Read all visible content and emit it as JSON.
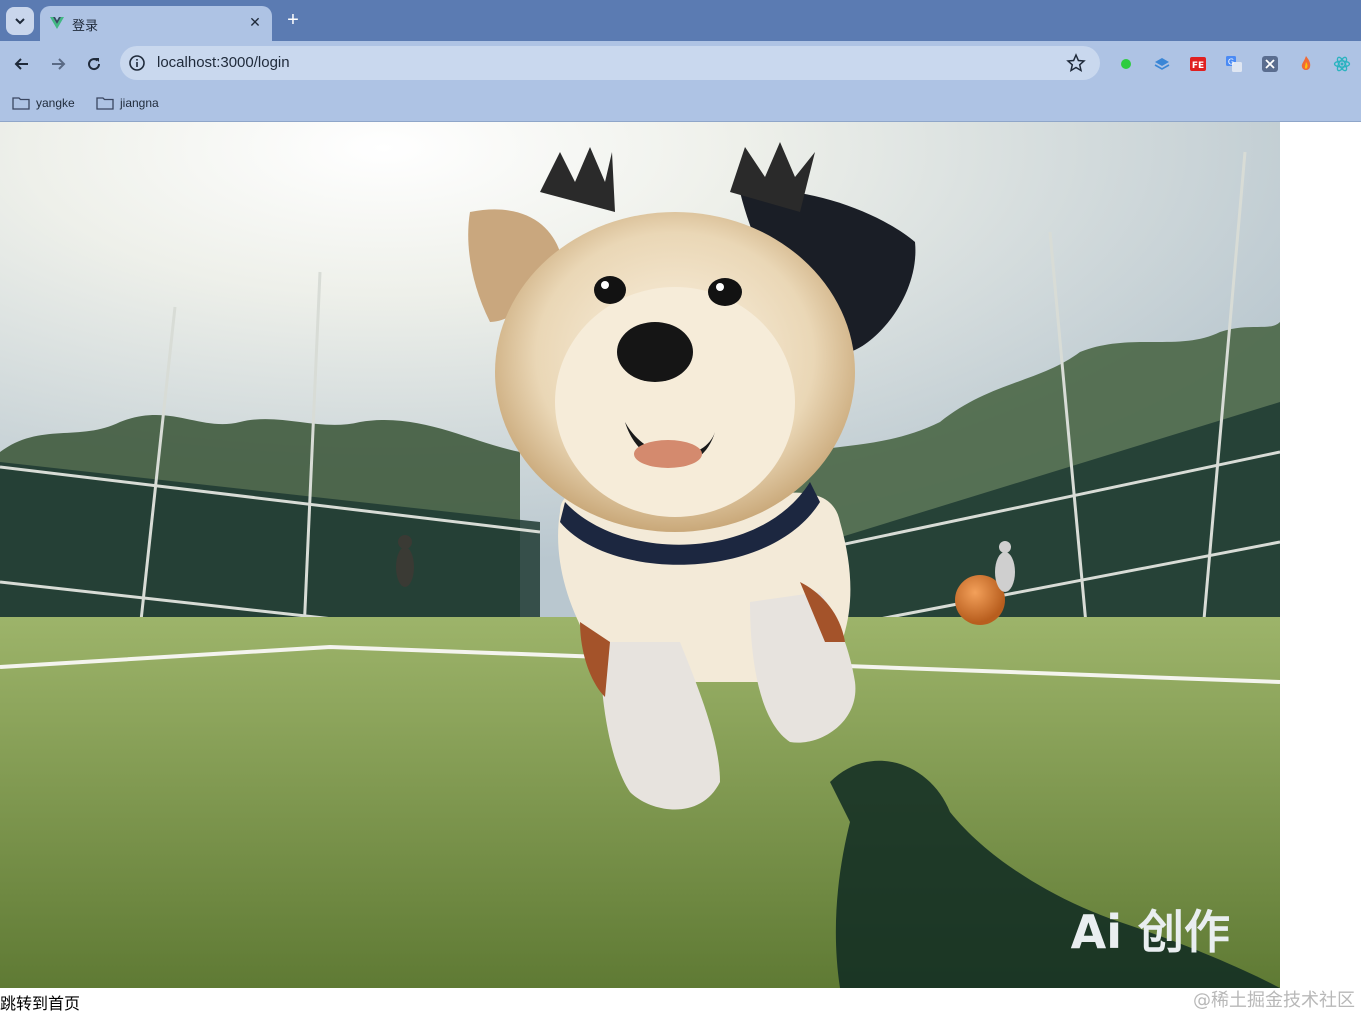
{
  "tab": {
    "title": "登录"
  },
  "address_bar": {
    "url": "localhost:3000/login"
  },
  "bookmarks": [
    {
      "label": "yangke"
    },
    {
      "label": "jiangna"
    }
  ],
  "page": {
    "hero_caption": "Ai 创作",
    "link_text": "跳转到首页"
  },
  "watermark": "@稀土掘金技术社区",
  "colors": {
    "tab_strip": "#5b7bb2",
    "toolbar": "#aec3e4",
    "favicon": "#41b883"
  },
  "icons": [
    "tab-search-icon",
    "vue-favicon-icon",
    "close-icon",
    "plus-icon",
    "back-arrow-icon",
    "forward-arrow-icon",
    "reload-icon",
    "info-icon",
    "star-icon",
    "folder-icon"
  ]
}
